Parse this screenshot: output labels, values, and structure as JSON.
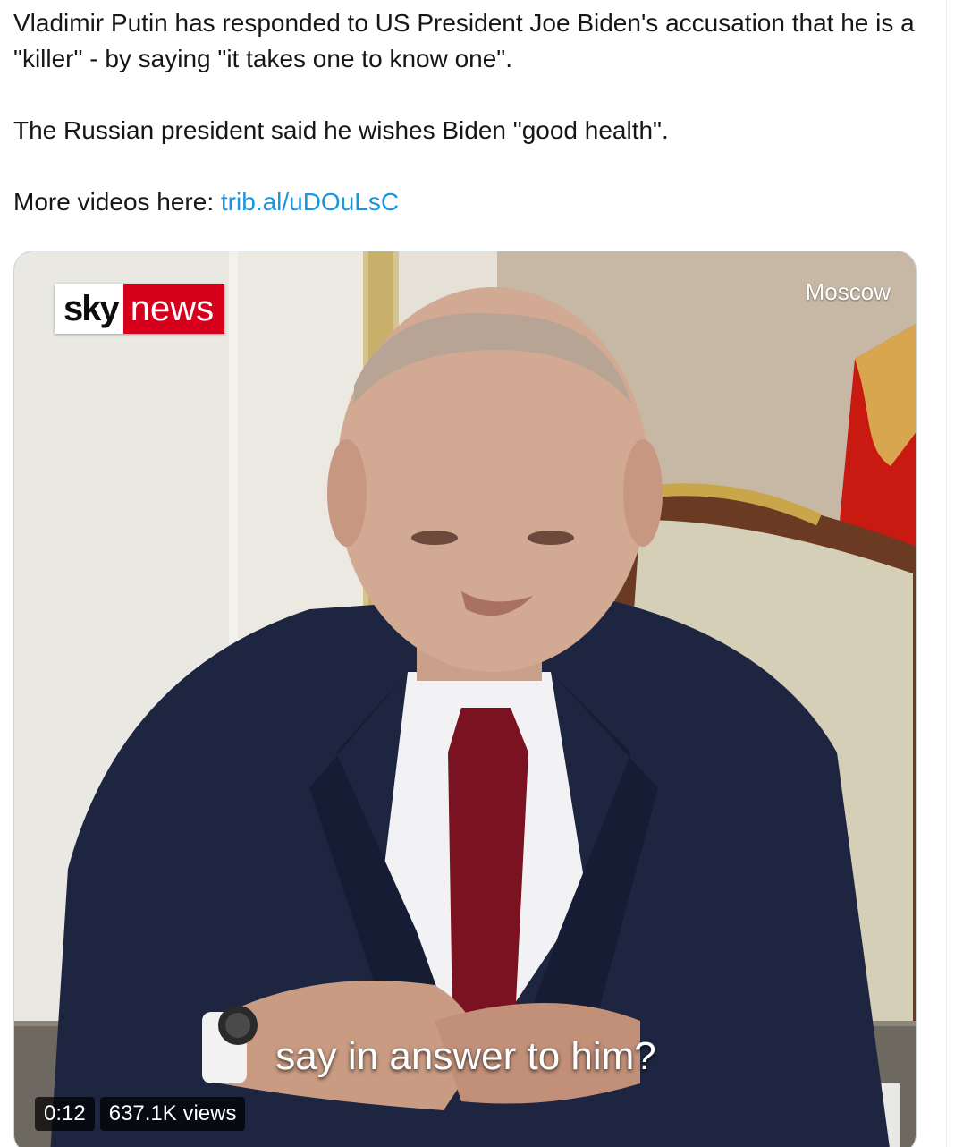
{
  "tweet": {
    "paragraph1": "Vladimir Putin has responded to US President Joe Biden's accusation that he is a \"killer\" - by saying \"it takes one to know one\".",
    "paragraph2": "The Russian president said he wishes Biden \"good health\".",
    "more_videos_prefix": "More videos here: ",
    "more_videos_link": "trib.al/uDOuLsC"
  },
  "video": {
    "logo_sky": "sky",
    "logo_news": "news",
    "location": "Moscow",
    "subtitle": "say in answer to him?",
    "elapsed": "0:12",
    "views": "637.1K views"
  },
  "colors": {
    "link": "#1b95e0",
    "text": "#14171a",
    "sky_red": "#d6001c"
  }
}
